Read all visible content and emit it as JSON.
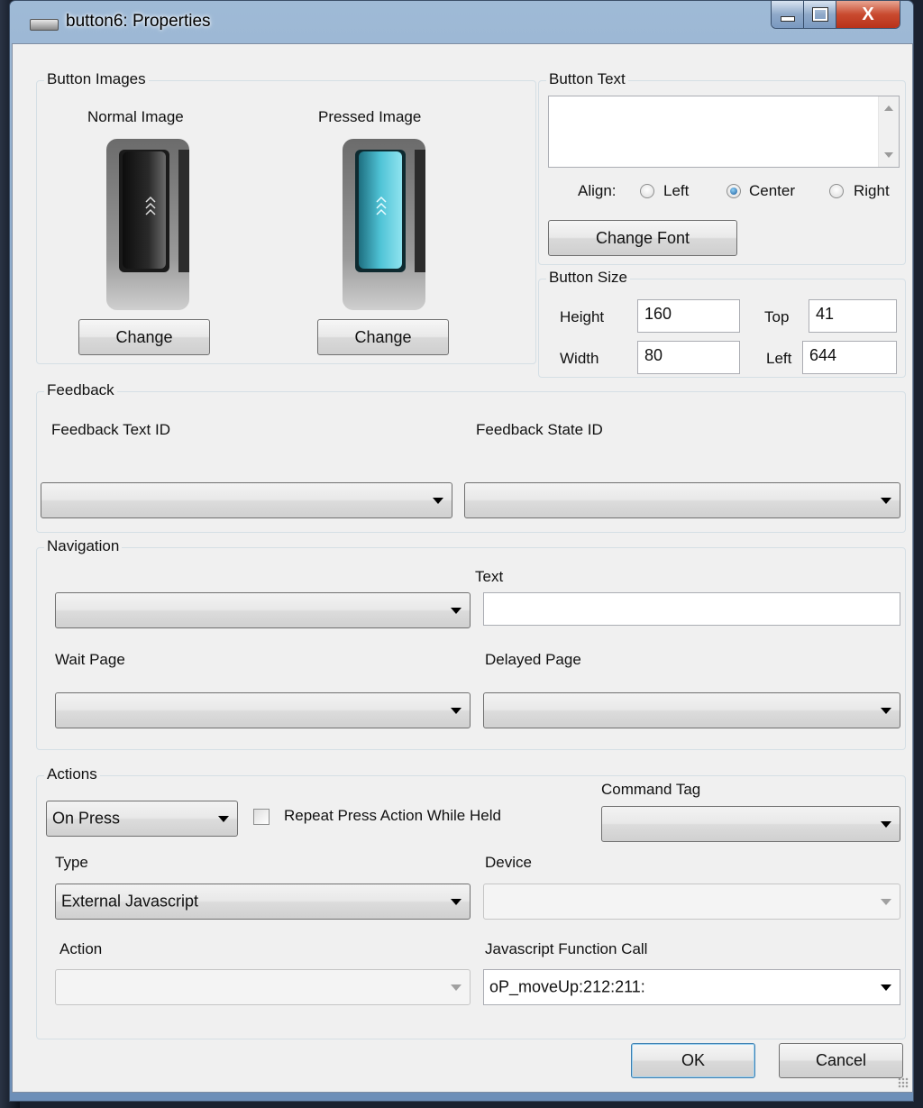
{
  "window": {
    "title": "button6: Properties",
    "close_glyph": "X"
  },
  "button_images": {
    "title": "Button Images",
    "normal_label": "Normal Image",
    "pressed_label": "Pressed Image",
    "change_normal": "Change",
    "change_pressed": "Change"
  },
  "button_text": {
    "title": "Button Text",
    "value": "",
    "align_label": "Align:",
    "align_options": [
      "Left",
      "Center",
      "Right"
    ],
    "align_selected": "Center",
    "change_font": "Change Font"
  },
  "button_size": {
    "title": "Button Size",
    "height_label": "Height",
    "height_value": "160",
    "width_label": "Width",
    "width_value": "80",
    "top_label": "Top",
    "top_value": "41",
    "left_label": "Left",
    "left_value": "644"
  },
  "feedback": {
    "title": "Feedback",
    "text_id_label": "Feedback Text ID",
    "text_id_value": "",
    "state_id_label": "Feedback State ID",
    "state_id_value": ""
  },
  "navigation": {
    "title": "Navigation",
    "page_value": "",
    "text_label": "Text",
    "text_value": "",
    "wait_label": "Wait Page",
    "wait_value": "",
    "delayed_label": "Delayed Page",
    "delayed_value": ""
  },
  "actions": {
    "title": "Actions",
    "trigger_value": "On Press",
    "repeat_label": "Repeat Press Action While Held",
    "repeat_checked": false,
    "command_tag_label": "Command Tag",
    "command_tag_value": "",
    "type_label": "Type",
    "type_value": "External Javascript",
    "device_label": "Device",
    "device_value": "",
    "action_label": "Action",
    "action_value": "",
    "js_label": "Javascript Function Call",
    "js_value": "oP_moveUp:212:211:"
  },
  "footer": {
    "ok": "OK",
    "cancel": "Cancel"
  },
  "colors": {
    "accent": "#3c7fb1",
    "pressed_glow": "#4fc3d6",
    "titlebar": "#9fbad6"
  }
}
